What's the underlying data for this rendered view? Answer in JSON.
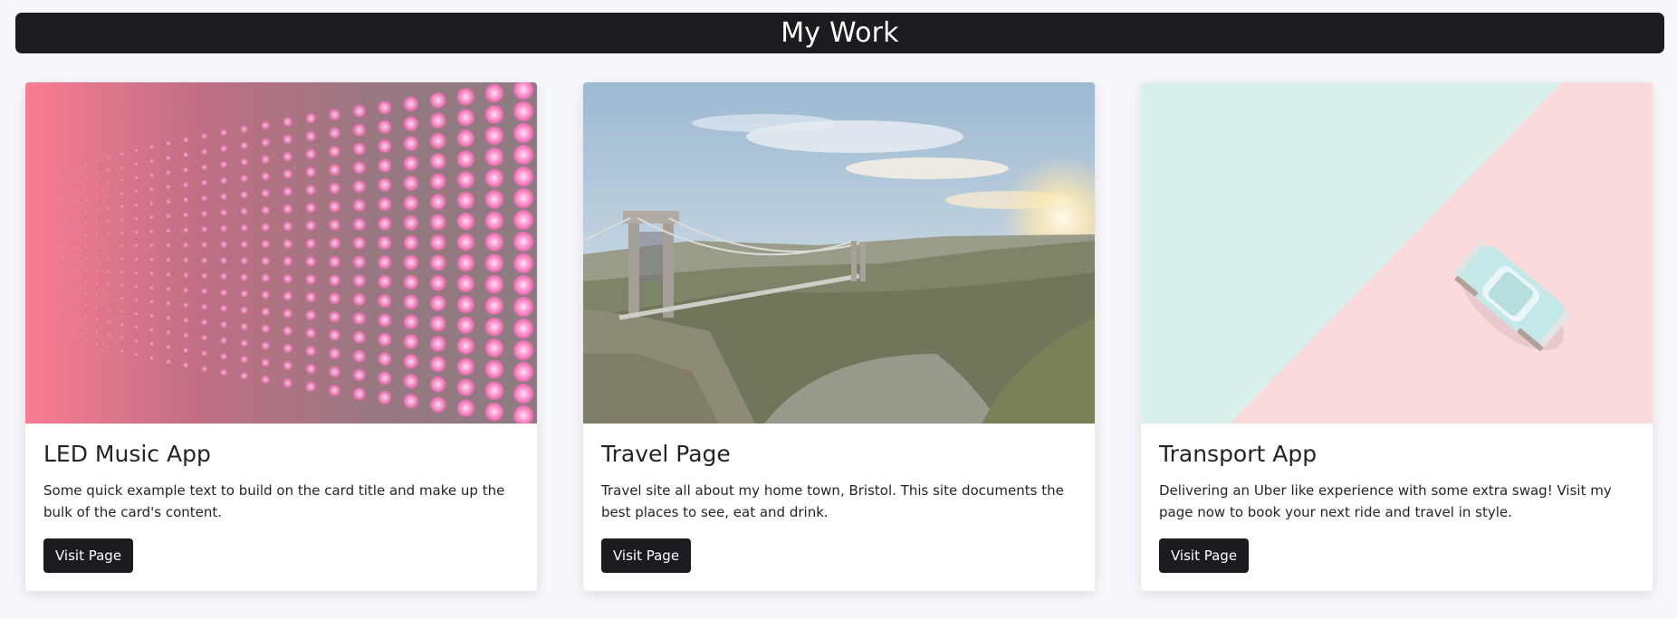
{
  "header": {
    "title": "My Work"
  },
  "cards": [
    {
      "image": "led-lights-wall-image",
      "title": "LED Music App",
      "text": "Some quick example text to build on the card title and make up the bulk of the card's content.",
      "button": "Visit Page"
    },
    {
      "image": "suspension-bridge-landscape-image",
      "title": "Travel Page",
      "text": "Travel site all about my home town, Bristol. This site documents the best places to see, eat and drink.",
      "button": "Visit Page"
    },
    {
      "image": "toy-car-pastel-background-image",
      "title": "Transport App",
      "text": "Delivering an Uber like experience with some extra swag! Visit my page now to book your next ride and travel in style.",
      "button": "Visit Page"
    }
  ],
  "colors": {
    "header_bg": "#1b1c20",
    "button_bg": "#1b1c20",
    "page_bg": "#f7f7fb",
    "led_pink": "#f4698a",
    "mint": "#d6efec",
    "pastel_pink": "#fbd7da"
  }
}
